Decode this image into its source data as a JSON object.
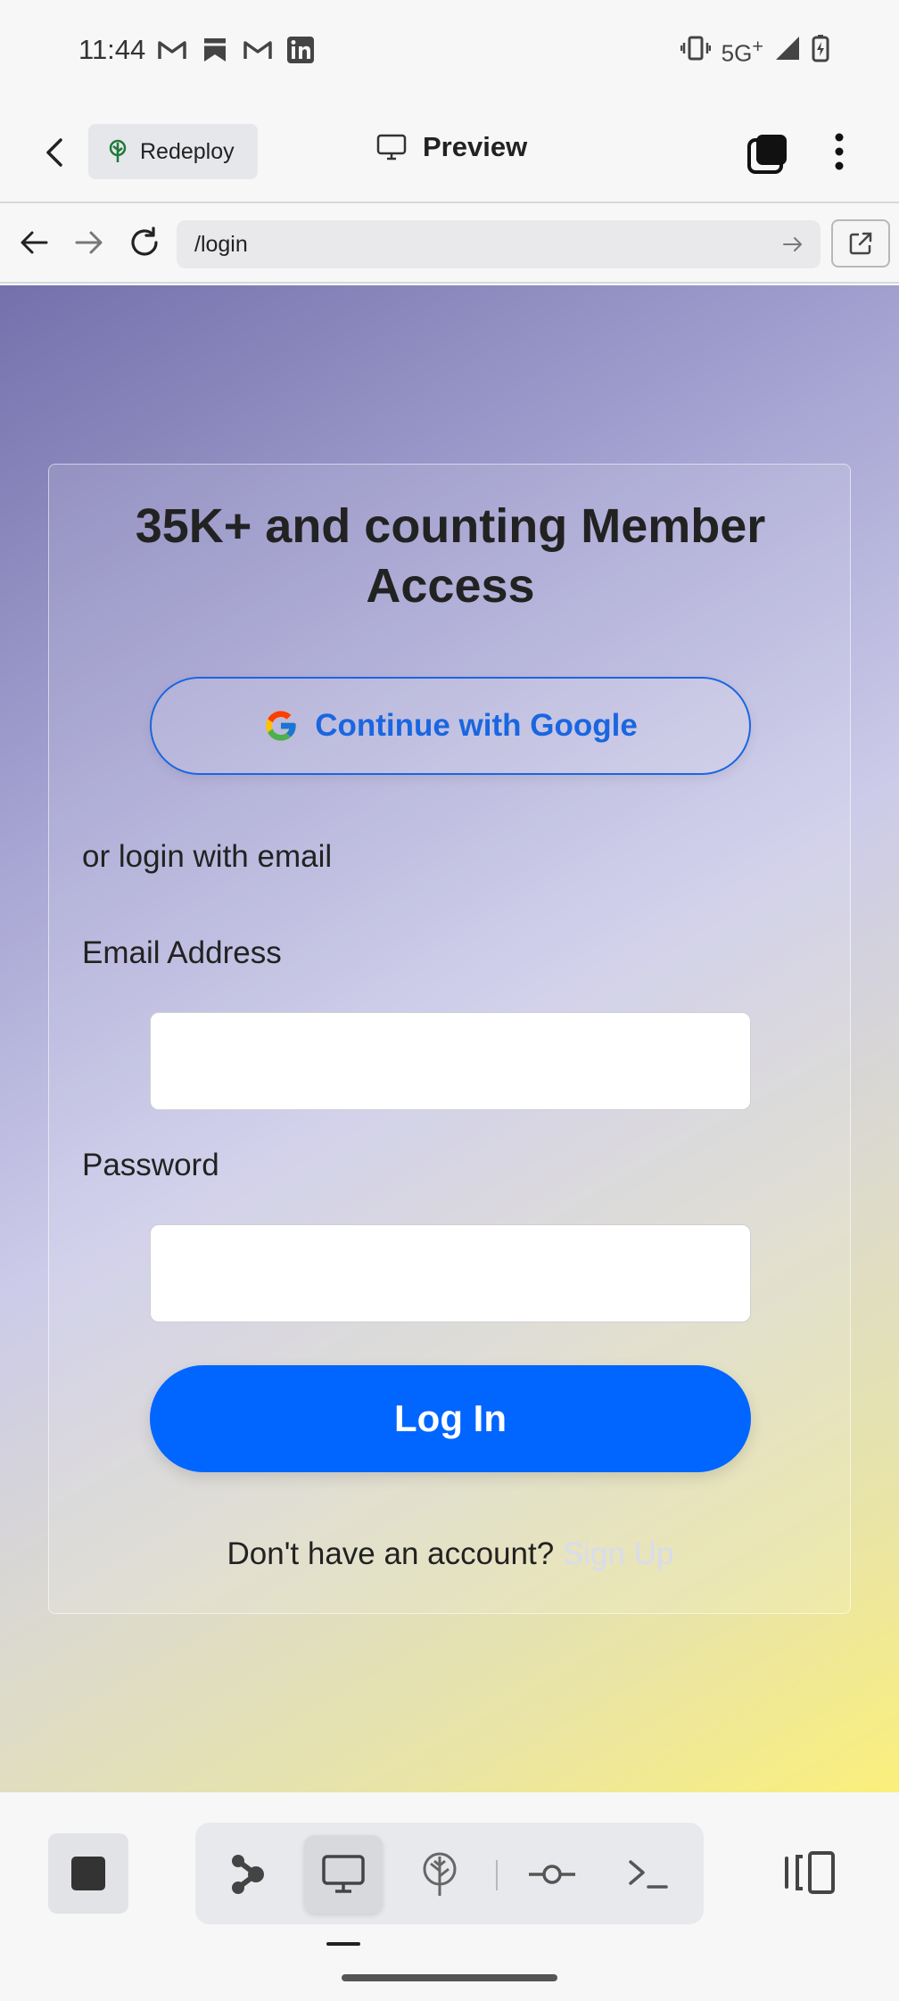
{
  "status_bar": {
    "time": "11:44",
    "network": "5G",
    "network_sup": "+",
    "left_icons": [
      "gmail-icon",
      "bookmark-icon",
      "gmail-icon",
      "linkedin-icon"
    ],
    "right_icons": [
      "vibrate-icon",
      "signal-icon",
      "battery-charging-icon"
    ]
  },
  "app_header": {
    "redeploy_label": "Redeploy",
    "preview_label": "Preview"
  },
  "browser": {
    "url": "/login"
  },
  "login": {
    "title": "35K+ and counting Member Access",
    "google_button": "Continue with Google",
    "or_label": "or login with email",
    "email_label": "Email Address",
    "email_value": "",
    "password_label": "Password",
    "password_value": "",
    "login_button": "Log In",
    "no_account_text": "Don't have an account?",
    "signup_link": "Sign Up"
  },
  "colors": {
    "primary": "#0066ff",
    "google_blue": "#1a66e0",
    "signup_link": "#d8dbf0",
    "gradient_start": "#7470ac",
    "gradient_end": "#fbef7c"
  },
  "toolbar": {
    "items": [
      "stop-icon",
      "agent-icon",
      "preview-desktop-icon",
      "deploy-icon",
      "commit-icon",
      "terminal-icon",
      "panel-toggle-icon"
    ],
    "active": "preview-desktop-icon"
  }
}
